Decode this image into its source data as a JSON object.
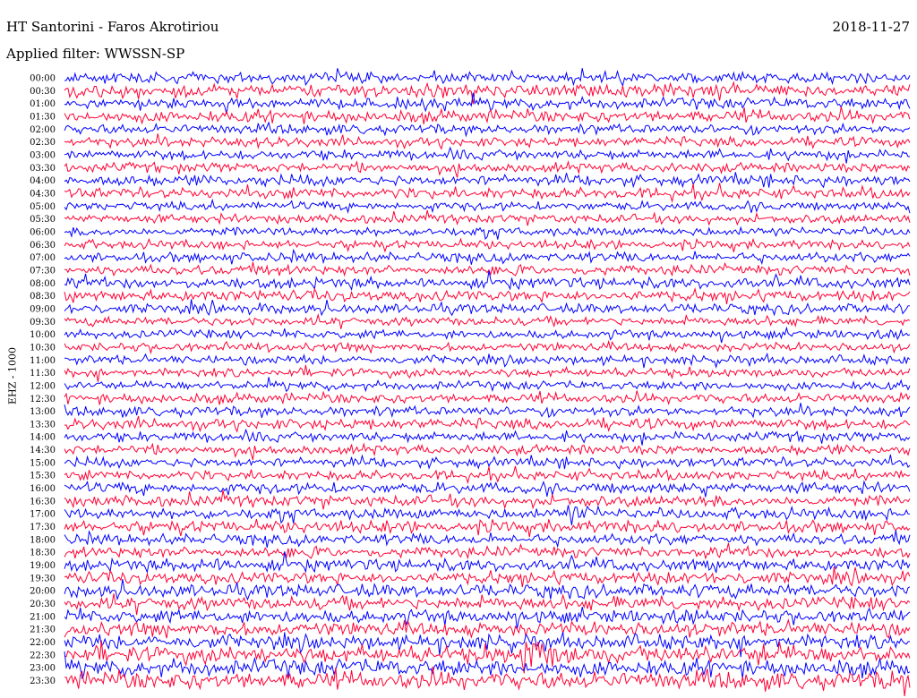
{
  "header": {
    "station": "HT Santorini - Faros Akrotiriou",
    "date": "2018-11-27",
    "filter": "Applied filter: WWSSN-SP"
  },
  "chart_data": {
    "type": "line",
    "title": "HT Santorini - Faros Akrotiriou",
    "channel_label": "EHZ - 1000",
    "row_labels": [
      "00:00",
      "00:30",
      "01:00",
      "01:30",
      "02:00",
      "02:30",
      "03:00",
      "03:30",
      "04:00",
      "04:30",
      "05:00",
      "05:30",
      "06:00",
      "06:30",
      "07:00",
      "07:30",
      "08:00",
      "08:30",
      "09:00",
      "09:30",
      "10:00",
      "10:30",
      "11:00",
      "11:30",
      "12:00",
      "12:30",
      "13:00",
      "13:30",
      "14:00",
      "14:30",
      "15:00",
      "15:30",
      "16:00",
      "16:30",
      "17:00",
      "17:30",
      "18:00",
      "18:30",
      "19:00",
      "19:30",
      "20:00",
      "20:30",
      "21:00",
      "21:30",
      "22:00",
      "22:30",
      "23:00",
      "23:30"
    ],
    "minutes_per_row": 30,
    "series_colors": [
      "#0000ff",
      "#ff0033"
    ],
    "relative_amplitude": [
      1.0,
      1.2,
      1.0,
      1.1,
      0.9,
      0.9,
      0.9,
      0.9,
      1.0,
      1.0,
      0.8,
      0.8,
      0.8,
      0.8,
      0.9,
      0.9,
      1.0,
      1.0,
      0.9,
      0.8,
      0.8,
      0.8,
      0.8,
      0.8,
      0.8,
      0.9,
      0.9,
      1.0,
      0.9,
      0.9,
      0.9,
      0.9,
      1.0,
      1.0,
      1.0,
      1.1,
      1.0,
      1.0,
      1.1,
      1.1,
      1.2,
      1.2,
      1.2,
      1.3,
      1.3,
      1.5,
      1.5,
      1.6
    ],
    "events": [
      {
        "row": "17:00",
        "position": 0.6,
        "relative_amplitude": 2.2
      },
      {
        "row": "19:00",
        "position": 0.16,
        "relative_amplitude": 1.6
      },
      {
        "row": "22:30",
        "position": 0.55,
        "relative_amplitude": 3.0
      },
      {
        "row": "22:30",
        "position": 0.83,
        "relative_amplitude": 1.8
      },
      {
        "row": "23:30",
        "position": 0.98,
        "relative_amplitude": 1.6
      }
    ]
  }
}
